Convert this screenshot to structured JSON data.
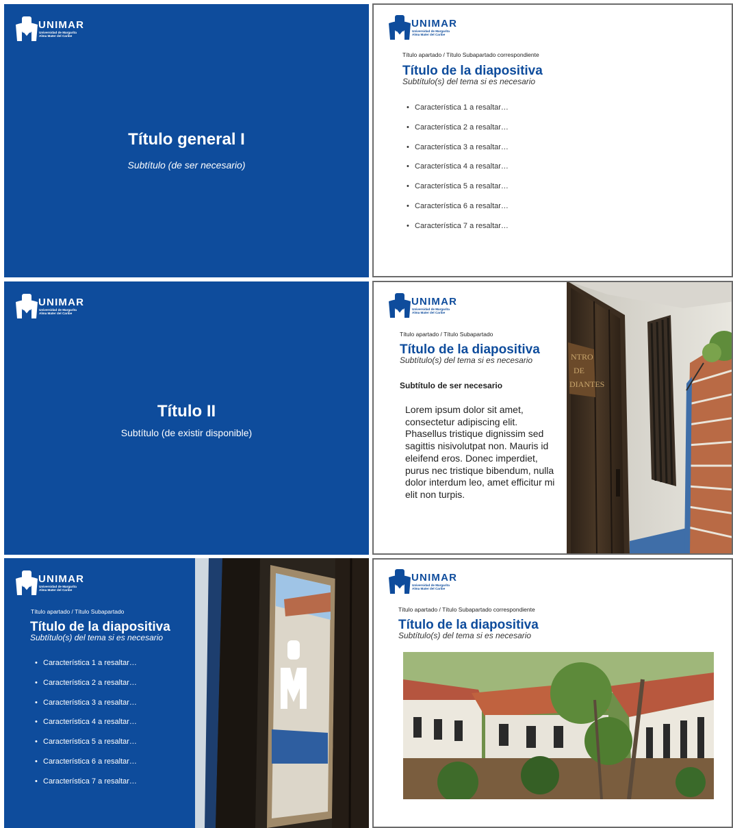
{
  "logo": {
    "name": "UNIMAR",
    "line1": "Universidad de Margarita",
    "line2": "Alma Mater del Caribe"
  },
  "slide1": {
    "title": "Título general I",
    "subtitle": "Subtítulo (de ser necesario)"
  },
  "slide2": {
    "breadcrumb": "Título apartado / Título  Subapartado correspondiente",
    "title": "Título de la diapositiva",
    "subtitle": "Subtítulo(s) del tema si es necesario",
    "bullets": [
      "Característica 1 a resaltar…",
      "Característica 2 a resaltar…",
      "Característica 3 a resaltar…",
      "Característica 4 a resaltar…",
      "Característica 5 a resaltar…",
      "Característica 6 a resaltar…",
      "Característica 7 a resaltar…"
    ]
  },
  "slide3": {
    "title": "Título II",
    "subtitle": "Subtítulo (de existir disponible)"
  },
  "slide4": {
    "breadcrumb": "Título apartado / Título  Subapartado",
    "title": "Título de la diapositiva",
    "subtitle": "Subtítulo(s) del tema si es necesario",
    "section": "Subtítulo de ser necesario",
    "body": "Lorem ipsum dolor sit amet, consectetur adipiscing elit. Phasellus tristique dignissim sed sagittis nisivolutpat non. Mauris id eleifend eros. Donec imperdiet, purus nec tristique bibendum, nulla dolor interdum leo, amet efficitur mi elit non turpis.",
    "sign_text": "NTRO DE DIANTES"
  },
  "slide5": {
    "breadcrumb": "Título apartado / Título  Subapartado",
    "title": "Título de la diapositiva",
    "subtitle": "Subtítulo(s) del tema si es necesario",
    "bullets": [
      "Característica 1 a resaltar…",
      "Característica 2 a resaltar…",
      "Característica 3 a resaltar…",
      "Característica 4 a resaltar…",
      "Característica 5 a resaltar…",
      "Característica 6 a resaltar…",
      "Característica 7 a resaltar…"
    ]
  },
  "slide6": {
    "breadcrumb": "Título apartado / Título  Subapartado correspondiente",
    "title": "Título de la diapositiva",
    "subtitle": "Subtítulo(s) del tema si es necesario"
  },
  "colors": {
    "brand_blue": "#0e4c9c",
    "border_gray": "#6a6a6a"
  }
}
